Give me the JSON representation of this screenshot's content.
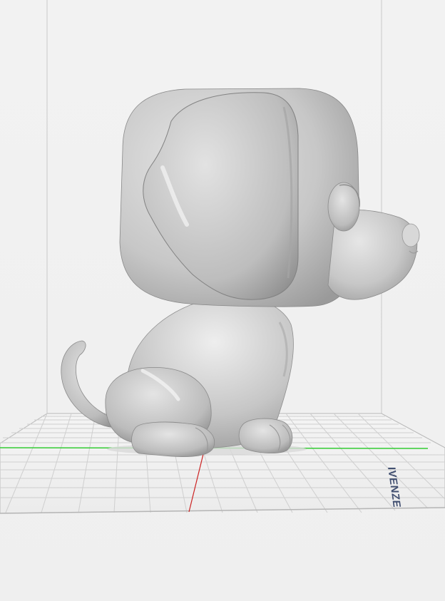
{
  "scene": {
    "view": "3d-print-preview",
    "model_name": "cartoon-dog-figurine",
    "model_color": "#c9c9c9",
    "background_color": "#f1f1f1",
    "grid_color": "#bdbdbd",
    "x_axis_color": "#33cc33",
    "y_axis_color": "#cc2222"
  },
  "watermark": {
    "text": "IVENZE"
  }
}
